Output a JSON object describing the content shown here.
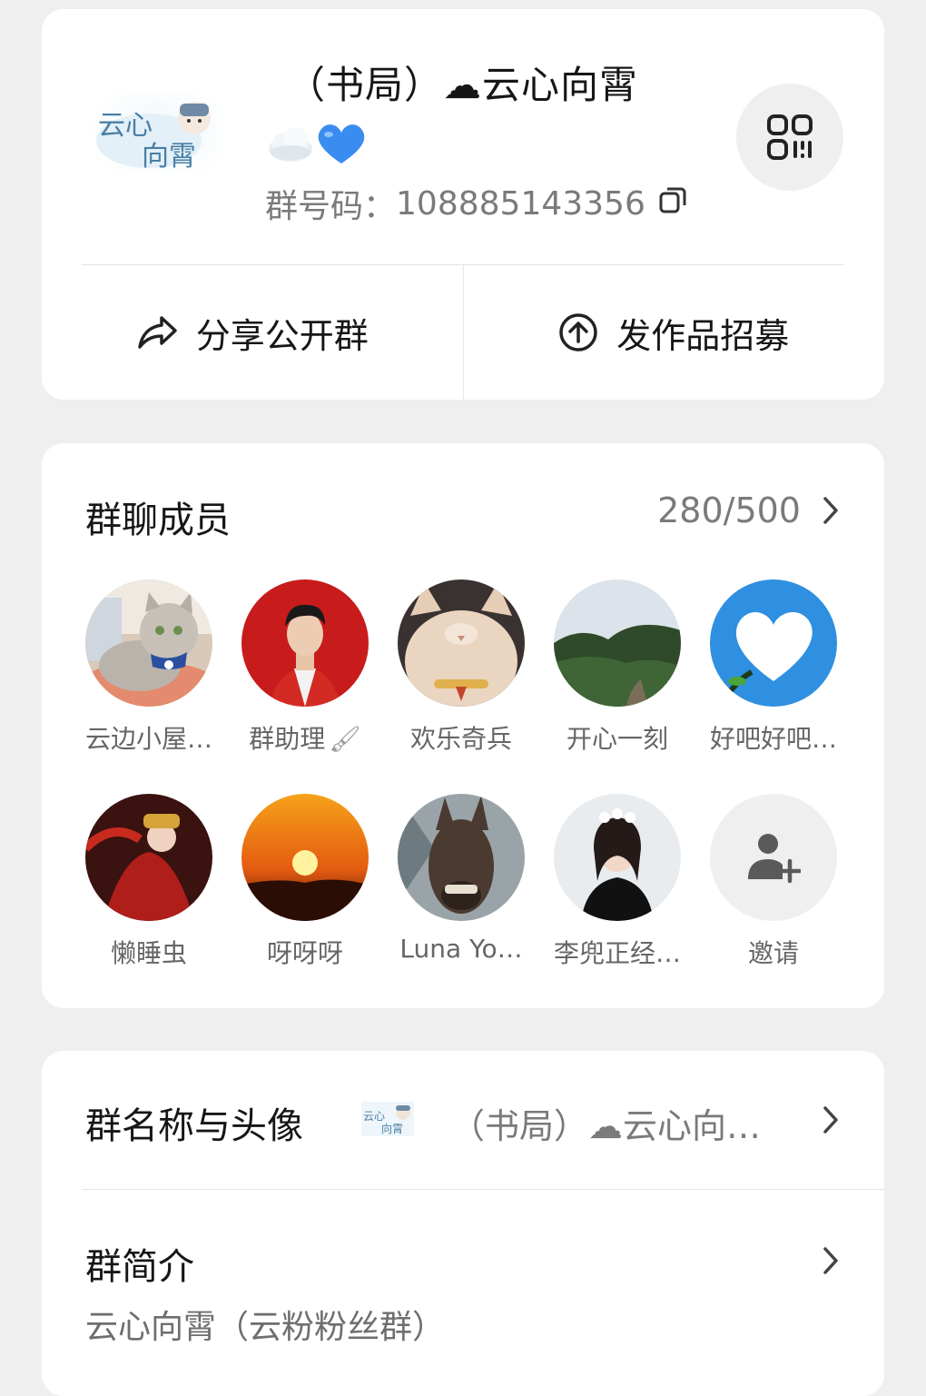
{
  "header": {
    "logo_text_top": "云心",
    "logo_text_bottom": "向霄",
    "group_title": "（书局）☁云心向霄",
    "title_emoji": [
      "cloud-emoji",
      "blue-heart-emoji"
    ],
    "group_id_label": "群号码：",
    "group_id_value": "108885143356"
  },
  "actions": {
    "share_label": "分享公开群",
    "post_label": "发作品招募"
  },
  "members": {
    "title": "群聊成员",
    "count": "280/500",
    "list": [
      {
        "name": "云边小屋…",
        "avatar": "cat-on-pillow"
      },
      {
        "name": "群助理",
        "avatar": "man-red-background",
        "badge": "brush-icon"
      },
      {
        "name": "欢乐奇兵",
        "avatar": "white-cat"
      },
      {
        "name": "开心一刻",
        "avatar": "trees-landscape"
      },
      {
        "name": "好吧好吧…",
        "avatar": "heart-cloud"
      },
      {
        "name": "懒睡虫",
        "avatar": "opera-performer"
      },
      {
        "name": "呀呀呀",
        "avatar": "sunset"
      },
      {
        "name": "Luna Yo…",
        "avatar": "donkey"
      },
      {
        "name": "李兜正经…",
        "avatar": "girl-with-flowers"
      },
      {
        "name": "邀请",
        "avatar": "invite-icon"
      }
    ]
  },
  "settings": {
    "name_avatar_label": "群名称与头像",
    "name_avatar_value": "（书局）☁云心向…",
    "intro_label": "群简介",
    "intro_text": "云心向霄（云粉粉丝群）"
  },
  "colors": {
    "background": "#efefef",
    "card": "#ffffff",
    "secondary_text": "#7a7a7a",
    "heart": "#3b8cf0"
  }
}
